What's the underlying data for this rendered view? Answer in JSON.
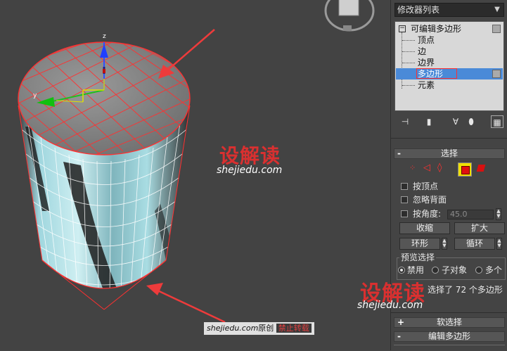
{
  "modifier_list": {
    "label": "修改器列表"
  },
  "stack": {
    "root": "可编辑多边形",
    "items": [
      "顶点",
      "边",
      "边界",
      "多边形",
      "元素"
    ],
    "selected_index": 3
  },
  "selection_rollout": {
    "title": "选择",
    "by_vertex": "按顶点",
    "ignore_backfacing": "忽略背面",
    "by_angle": "按角度:",
    "angle_value": "45.0",
    "shrink": "收缩",
    "grow": "扩大",
    "ring": "环形",
    "loop": "循环",
    "preview_title": "预览选择",
    "preview_disabled": "禁用",
    "preview_subobject": "子对象",
    "preview_multi": "多个",
    "status": "选择了 72 个多边形"
  },
  "soft_selection": {
    "title": "软选择"
  },
  "edit_polygons": {
    "title": "编辑多边形"
  },
  "viewport": {
    "gizmo_labels": {
      "z": "z",
      "y": "y"
    }
  },
  "watermarks": {
    "logo": "设解读",
    "site": "shejiedu.com",
    "footer_site": "shejiedu.com",
    "footer_original": "原创",
    "footer_forbid": "禁止转载"
  },
  "colors": {
    "selection_red": "#ff3030",
    "highlight_blue": "#4a8ad8",
    "watermark_red": "#d93030",
    "arrow_red": "#ee3b3b"
  }
}
